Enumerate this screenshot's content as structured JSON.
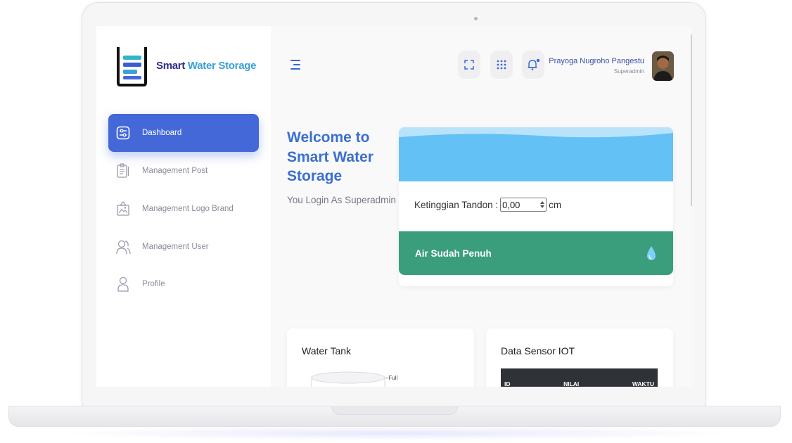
{
  "app": {
    "brand_part1": "Smart",
    "brand_part2": "Water Storage",
    "brand_color_dark": "#2e2e8a",
    "brand_color_light": "#3aa0d8"
  },
  "sidebar": {
    "items": [
      {
        "label": "Dashboard",
        "icon": "dashboard-icon",
        "active": true
      },
      {
        "label": "Management Post",
        "icon": "clipboard-icon",
        "active": false
      },
      {
        "label": "Management Logo Brand",
        "icon": "image-frame-icon",
        "active": false
      },
      {
        "label": "Management User",
        "icon": "users-icon",
        "active": false
      },
      {
        "label": "Profile",
        "icon": "user-icon",
        "active": false
      }
    ],
    "active_color": "#4468d8"
  },
  "header": {
    "menu_icon": "hamburger-icon",
    "buttons": [
      "fullscreen-icon",
      "apps-grid-icon",
      "notification-bell-icon"
    ],
    "user_name": "Prayoga Nugroho Pangestu",
    "user_role": "Superadmin"
  },
  "welcome": {
    "title": "Welcome to Smart Water Storage",
    "subtitle": "You Login As Superadmin"
  },
  "tank": {
    "level_label": "Ketinggian Tandon :",
    "level_value": "0,00",
    "unit": "cm",
    "status": "Air Sudah Penuh",
    "status_icon": "water-drop-icon",
    "water_color": "#63c1f6",
    "status_color": "#3a9e7c"
  },
  "water_tank_card": {
    "title": "Water Tank",
    "marker_label": "Full"
  },
  "sensor_card": {
    "title": "Data Sensor IOT",
    "columns": [
      "ID",
      "NILAI",
      "WAKTU"
    ]
  }
}
